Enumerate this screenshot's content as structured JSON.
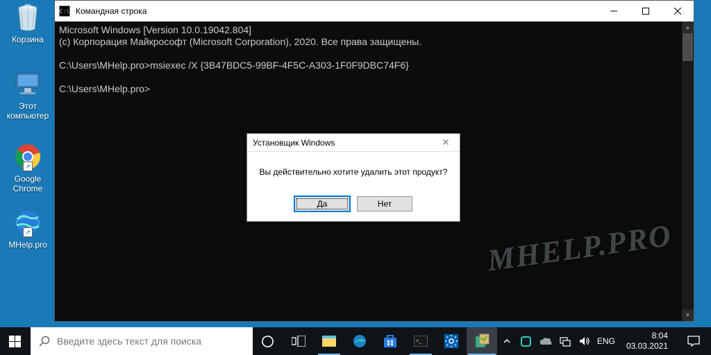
{
  "desktop": {
    "icons": [
      {
        "label": "Корзина"
      },
      {
        "label": "Этот компьютер"
      },
      {
        "label": "Google Chrome"
      },
      {
        "label": "MHelp.pro"
      }
    ]
  },
  "cmd": {
    "title": "Командная строка",
    "lines": {
      "l1": "Microsoft Windows [Version 10.0.19042.804]",
      "l2": "(c) Корпорация Майкрософт (Microsoft Corporation), 2020. Все права защищены.",
      "l3": "",
      "l4": "C:\\Users\\MHelp.pro>msiexec /X {3B47BDC5-99BF-4F5C-A303-1F0F9DBC74F6}",
      "l5": "",
      "l6": "C:\\Users\\MHelp.pro>"
    }
  },
  "dialog": {
    "title": "Установщик Windows",
    "message": "Вы действительно хотите удалить этот продукт?",
    "yes": "Да",
    "no": "Нет"
  },
  "watermark": "MHELP.PRO",
  "taskbar": {
    "search_placeholder": "Введите здесь текст для поиска",
    "lang": "ENG",
    "time": "8:04",
    "date": "03.03.2021"
  }
}
